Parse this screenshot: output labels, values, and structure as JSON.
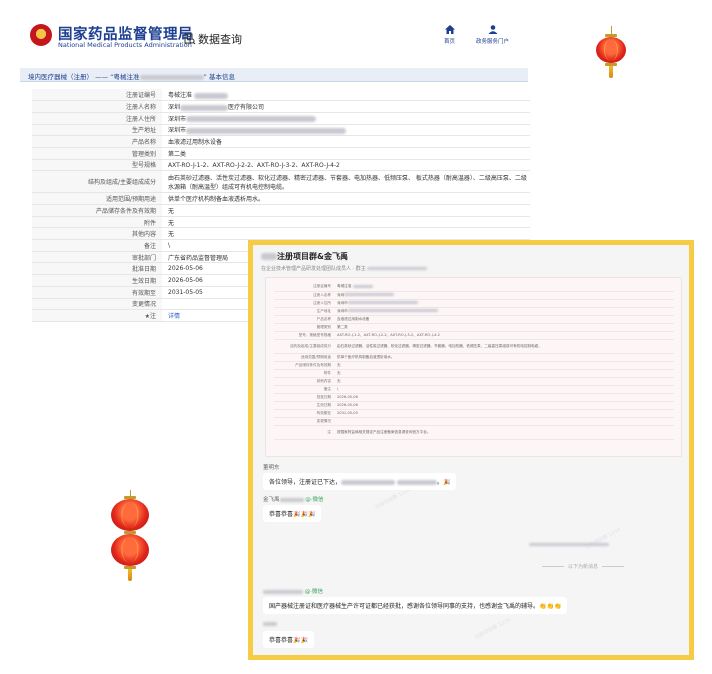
{
  "header": {
    "org_name_cn": "国家药品监督管理局",
    "org_name_en": "National Medical Products Administration",
    "query_label": "数据查询",
    "nav": [
      {
        "label": "首页",
        "icon": "home-icon"
      },
      {
        "label": "政务服务门户",
        "icon": "user-icon"
      }
    ]
  },
  "breadcrumb": {
    "section": "境内医疗器械（注册）",
    "separator": "——",
    "item_prefix": "“粤械注准",
    "item_suffix": "” 基本信息"
  },
  "record": {
    "rows": [
      {
        "key": "注册证编号",
        "value": "粤械注准",
        "redacted": true
      },
      {
        "key": "注册人名称",
        "value": "深圳",
        "value_suffix": "医疗有限公司",
        "redacted": true
      },
      {
        "key": "注册人住所",
        "value": "深圳市",
        "redacted": true
      },
      {
        "key": "生产地址",
        "value": "深圳市",
        "redacted": true
      },
      {
        "key": "产品名称",
        "value": "血液滤过用制水设备"
      },
      {
        "key": "管理类别",
        "value": "第二类"
      },
      {
        "key": "型号规格",
        "value": "AXT-RO-J-1-2、AXT-RO-J-2-2、AXT-RO-J-3-2、AXT-RO-J-4-2"
      },
      {
        "key": "结构及组成/主要组成成分",
        "value": "由石英砂过滤器、活性炭过滤器、软化过滤器、精密过滤器、节套器、电加热器、低频压泵、 板式热器（耐高温器）、二级高压泵、二级水源箱（耐高温型）组成可有机电控制电缆。",
        "tall": true
      },
      {
        "key": "适用范围/预期用途",
        "value": "供单个医疗机构制备血液透析用水。"
      },
      {
        "key": "产品储存条件及有效期",
        "value": "无"
      },
      {
        "key": "附件",
        "value": "无"
      },
      {
        "key": "其他内容",
        "value": "无"
      },
      {
        "key": "备注",
        "value": "\\"
      },
      {
        "key": "审批部门",
        "value": "广东省药品监督管理局"
      },
      {
        "key": "批准日期",
        "value": "2026-05-06"
      },
      {
        "key": "生效日期",
        "value": "2026-05-06"
      },
      {
        "key": "有效期至",
        "value": "2031-05-05"
      },
      {
        "key": "变更情况",
        "value": ""
      },
      {
        "key": "★注",
        "value": "详情",
        "link": true
      }
    ]
  },
  "chat": {
    "group_title": "注册项目群&金飞禹",
    "group_desc": "在企业技术管理产品研发处理团队成员人 · 群主",
    "image_rows": [
      {
        "key": "注册证编号",
        "value": "粤械注准"
      },
      {
        "key": "注册人名称",
        "value": "深圳"
      },
      {
        "key": "注册人住所",
        "value": "深圳市"
      },
      {
        "key": "生产地址",
        "value": "深圳市"
      },
      {
        "key": "产品名称",
        "value": "血液滤过用制水设备"
      },
      {
        "key": "管理类别",
        "value": "第二类"
      },
      {
        "key": "型号、规格型号规格",
        "value": "AXT-RO-J-1-2、AXT-RO-J-2-2、AXT-RO-J-3-2、AXT-RO-J-4-2"
      },
      {
        "key": "结构及组成/主要组成成分",
        "value": "由石英砂过滤器、活性炭过滤器、软化过滤器、精密过滤器、节套器、电加热器、低频压泵、二级高压泵组成可有机电控制电缆。",
        "tall": true
      },
      {
        "key": "适用范围/预期用途",
        "value": "供单个医疗机构制备血液透析用水。"
      },
      {
        "key": "产品储存条件及有效期",
        "value": "无"
      },
      {
        "key": "附件",
        "value": "无"
      },
      {
        "key": "其他内容",
        "value": "无"
      },
      {
        "key": "备注",
        "value": "\\"
      },
      {
        "key": "批准日期",
        "value": "2026-05-06"
      },
      {
        "key": "生效日期",
        "value": "2026-05-06"
      },
      {
        "key": "有效期至",
        "value": "2031-05-05"
      },
      {
        "key": "变更情况",
        "value": ""
      },
      {
        "key": "注",
        "value": "按国家药监局相关规定产品注册备案信息请查询官方平台。",
        "tall": true
      }
    ],
    "messages": [
      {
        "sender": "董明东",
        "sender_tag": "",
        "text": "各位领导，注册证已下达，",
        "text_suffix": "。🎉"
      },
      {
        "sender": "金飞禹",
        "sender_tag": "@·微信",
        "text": "恭喜恭喜🎉🎉🎉"
      },
      {
        "sender": "",
        "sender_tag": "@·微信",
        "text": "国产器械注册证和医疗器械生产许可证都已经获批，感谢各位领导同事的支持，也感谢金飞禹的辅导。👏👏👏"
      },
      {
        "sender": "",
        "sender_tag": "",
        "text": "恭喜恭喜🎉🎉"
      }
    ],
    "divider_text": "以下为新消息",
    "watermark_text": "注册项目群 1234"
  }
}
